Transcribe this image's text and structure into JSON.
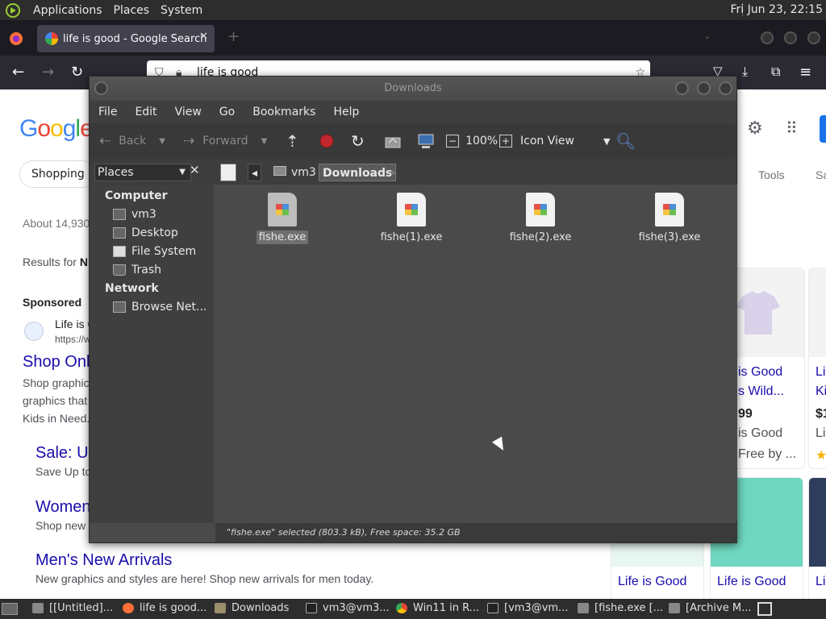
{
  "top_panel": {
    "menus": [
      "Applications",
      "Places",
      "System"
    ],
    "clock": "Fri Jun 23, 22:15"
  },
  "firefox": {
    "tab_title": "life is good - Google Search",
    "url_text": "life is good"
  },
  "google": {
    "chip": "Shopping",
    "results_count": "About 14,930",
    "results_for": "Results for",
    "results_for_bold": "N",
    "sponsored": "Sponsored",
    "ad_site": "Life is G",
    "ad_url": "https://w",
    "ad_title": "Shop Onl",
    "ad_desc1": "Shop graphic",
    "ad_desc2": "graphics that",
    "ad_desc3": "Kids in Need.",
    "sale_title": "Sale: U",
    "sale_desc": "Save Up to",
    "women_title": "Women",
    "women_desc": "Shop new",
    "men_title": "Men's New Arrivals",
    "men_desc": "New graphics and styles are here! Shop new arrivals for men today.",
    "tools": "Tools",
    "sa": "Sa",
    "products": [
      {
        "l1": "is Good",
        "l2": "s Wild...",
        "price": "99",
        "seller": "is Good",
        "ship": "Free by ..."
      },
      {
        "l1": "Li",
        "l2": "Ki",
        "price": "$1",
        "seller": "Li"
      }
    ],
    "bottom_products": [
      "Life is Good",
      "Life is Good",
      "Li"
    ]
  },
  "nautilus": {
    "title": "Downloads",
    "menu": [
      "File",
      "Edit",
      "View",
      "Go",
      "Bookmarks",
      "Help"
    ],
    "toolbar": {
      "back": "Back",
      "forward": "Forward",
      "zoom": "100%",
      "view_mode": "Icon View"
    },
    "places_combo": "Places",
    "breadcrumbs": [
      "vm3",
      "Downloads"
    ],
    "sidebar": {
      "computer_header": "Computer",
      "computer_items": [
        "vm3",
        "Desktop",
        "File System",
        "Trash"
      ],
      "network_header": "Network",
      "network_items": [
        "Browse Net..."
      ]
    },
    "files": [
      "fishe.exe",
      "fishe(1).exe",
      "fishe(2).exe",
      "fishe(3).exe"
    ],
    "status": "\"fishe.exe\" selected (803.3 kB), Free space: 35.2 GB"
  },
  "taskbar": {
    "tasks": [
      "[[Untitled]...",
      "life is good...",
      "Downloads",
      "vm3@vm3...",
      "Win11 in R...",
      "[vm3@vm...",
      "[fishe.exe [...",
      "[Archive M..."
    ]
  }
}
